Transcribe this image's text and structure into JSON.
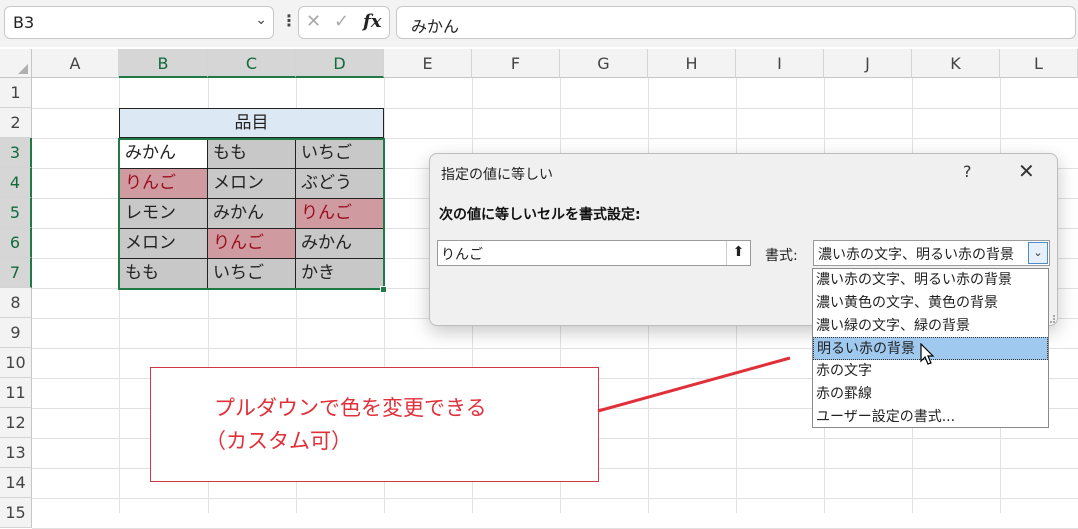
{
  "formula_bar": {
    "cell_ref": "B3",
    "content": "みかん",
    "fx": "fx",
    "cancel_glyph": "✕",
    "enter_glyph": "✓",
    "more_glyph": "⋮"
  },
  "columns": [
    "A",
    "B",
    "C",
    "D",
    "E",
    "F",
    "G",
    "H",
    "I",
    "J",
    "K",
    "L"
  ],
  "rows": [
    "1",
    "2",
    "3",
    "4",
    "5",
    "6",
    "7",
    "8",
    "9",
    "10",
    "11",
    "12",
    "13",
    "14",
    "15"
  ],
  "table": {
    "header": "品目",
    "cells": [
      [
        "みかん",
        "もも",
        "いちご"
      ],
      [
        "りんご",
        "メロン",
        "ぶどう"
      ],
      [
        "レモン",
        "みかん",
        "りんご"
      ],
      [
        "メロン",
        "りんご",
        "みかん"
      ],
      [
        "もも",
        "いちご",
        "かき"
      ]
    ],
    "highlight_fill": "#cf9aa0",
    "highlight_text": "#9a0d1c",
    "base_fill": "#c8c8c8"
  },
  "annotation": {
    "line1": "プルダウンで色を変更できる",
    "line2": "（カスタム可）",
    "color": "#e0303a"
  },
  "dialog": {
    "title": "指定の値に等しい",
    "help": "?",
    "close": "✕",
    "prompt": "次の値に等しいセルを書式設定:",
    "value": "りんご",
    "format_label": "書式:",
    "format_selected": "濃い赤の文字、明るい赤の背景",
    "options": [
      "濃い赤の文字、明るい赤の背景",
      "濃い黄色の文字、黄色の背景",
      "濃い緑の文字、緑の背景",
      "明るい赤の背景",
      "赤の文字",
      "赤の罫線",
      "ユーザー設定の書式..."
    ],
    "highlighted_option": 3
  }
}
